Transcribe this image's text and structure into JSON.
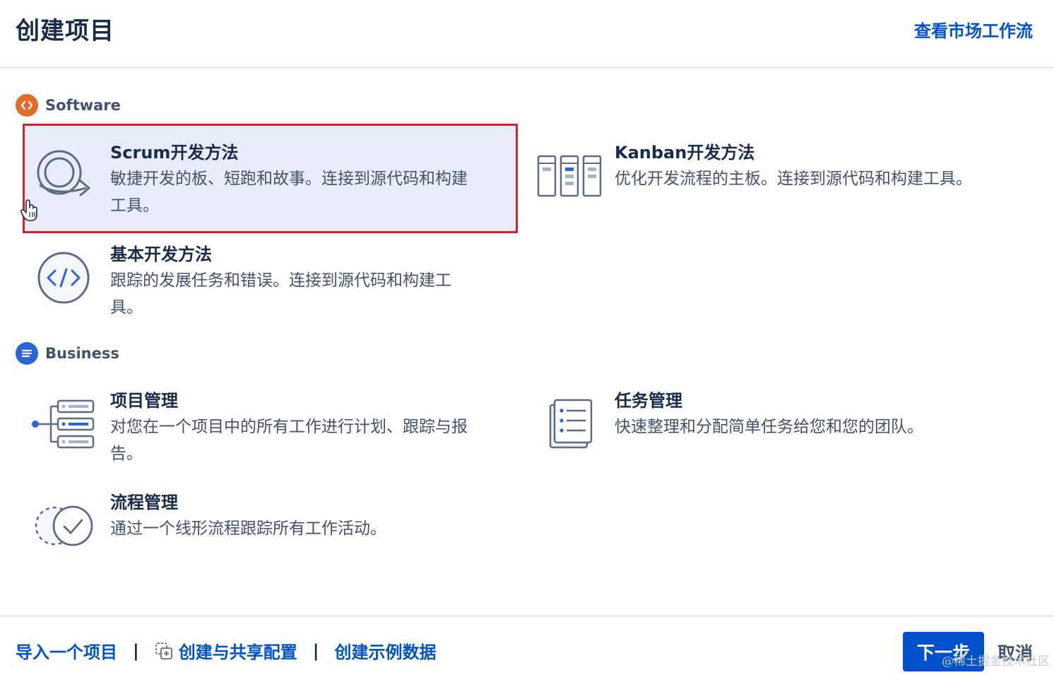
{
  "header": {
    "title": "创建项目",
    "market_link": "查看市场工作流"
  },
  "sections": {
    "software": {
      "label": "Software",
      "icon": "code-brackets-icon",
      "color": "#e46b25",
      "cards": [
        {
          "title": "Scrum开发方法",
          "desc_line1": "敏捷开发的板、短跑和故事。连接到源代码和构建",
          "desc_line2": "工具。",
          "icon": "scrum-loop-icon",
          "selected": true
        },
        {
          "title": "Kanban开发方法",
          "desc_line1": "优化开发流程的主板。连接到源代码和构建工具。",
          "icon": "kanban-board-icon"
        },
        {
          "title": "基本开发方法",
          "desc_line1": "跟踪的发展任务和错误。连接到源代码和构建工",
          "desc_line2": "具。",
          "icon": "code-circle-icon"
        }
      ]
    },
    "business": {
      "label": "Business",
      "icon": "list-lines-icon",
      "color": "#2b63d9",
      "cards": [
        {
          "title": "项目管理",
          "desc_line1": "对您在一个项目中的所有工作进行计划、跟踪与报",
          "desc_line2": "告。",
          "icon": "project-tree-icon"
        },
        {
          "title": "任务管理",
          "desc_line1": "快速整理和分配简单任务给您和您的团队。",
          "icon": "task-list-icon"
        },
        {
          "title": "流程管理",
          "desc_line1": "通过一个线形流程跟踪所有工作活动。",
          "icon": "process-check-icon"
        }
      ]
    }
  },
  "footer": {
    "import_link": "导入一个项目",
    "separator": "|",
    "share_config_link": "创建与共享配置",
    "sample_data_link": "创建示例数据",
    "next_button": "下一步",
    "cancel_button": "取消"
  },
  "watermark": "@稀土掘金技术社区",
  "colors": {
    "primary": "#0052cc",
    "selected_bg": "#e9edfb",
    "selected_border": "#d0242f",
    "text_dark": "#172b4d",
    "text_muted": "#42526e"
  }
}
